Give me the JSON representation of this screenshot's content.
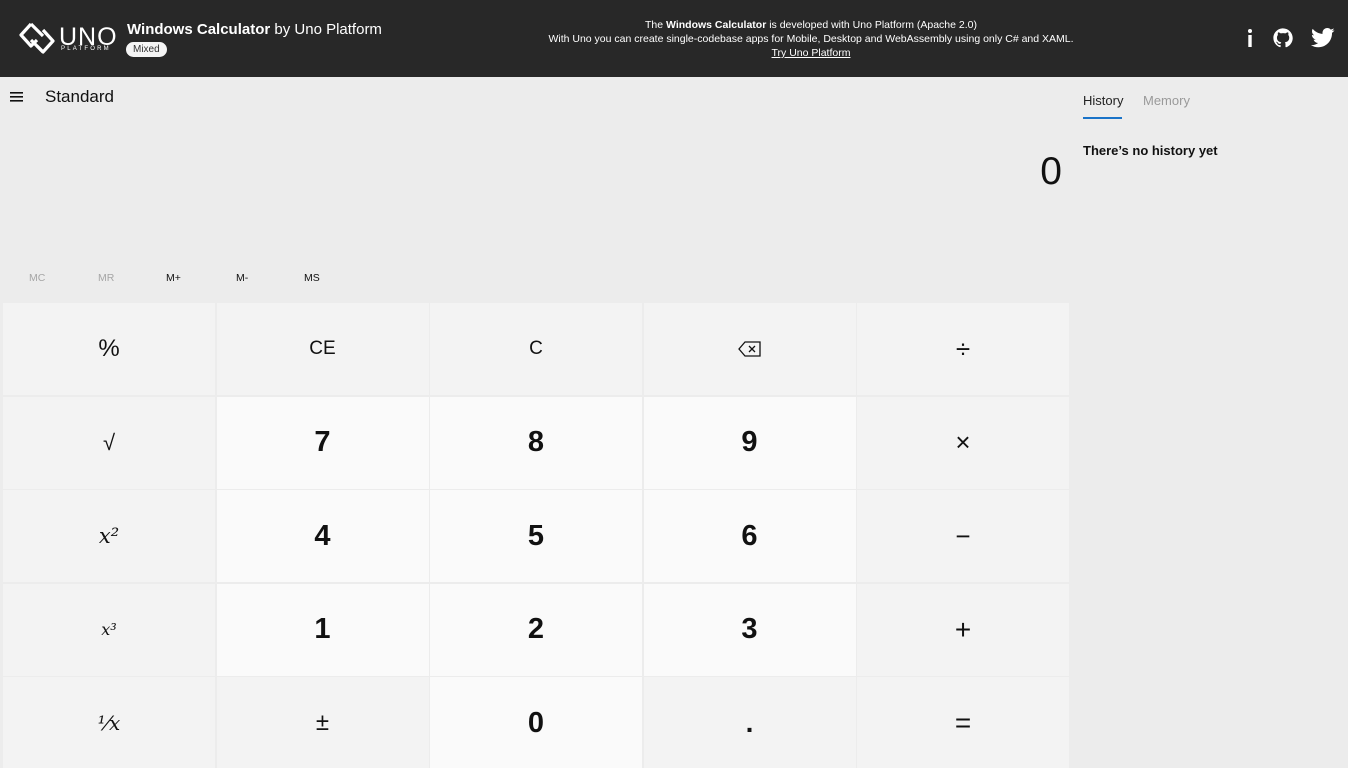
{
  "banner": {
    "logo_word": "UNO",
    "logo_sub": "PLATFORM",
    "brand_name": "Windows Calculator",
    "brand_suffix": " by Uno Platform",
    "badge": "Mixed",
    "notice_line1_pre": "The ",
    "notice_line1_bold": "Windows Calculator",
    "notice_line1_post": " is developed with Uno Platform (Apache 2.0)",
    "notice_line2": "With Uno you can create single-codebase apps for Mobile, Desktop and WebAssembly using only C# and XAML.",
    "notice_link": "Try Uno Platform",
    "icons": [
      "info-icon",
      "github-icon",
      "twitter-icon"
    ],
    "background": "#282828"
  },
  "header": {
    "menu_icon": "hamburger-menu-icon",
    "mode_title": "Standard"
  },
  "display": {
    "value": "0"
  },
  "memory": {
    "buttons": [
      {
        "label": "MC",
        "enabled": false
      },
      {
        "label": "MR",
        "enabled": false
      },
      {
        "label": "M+",
        "enabled": true
      },
      {
        "label": "M-",
        "enabled": true
      },
      {
        "label": "MS",
        "enabled": true
      }
    ]
  },
  "keypad": {
    "keys": [
      {
        "label": "%",
        "type": "fn"
      },
      {
        "label": "CE",
        "type": "fn"
      },
      {
        "label": "C",
        "type": "fn"
      },
      {
        "label": "⌫",
        "type": "fn",
        "icon": "backspace-icon"
      },
      {
        "label": "÷",
        "type": "fn"
      },
      {
        "label": "√",
        "type": "fn"
      },
      {
        "label": "7",
        "type": "num"
      },
      {
        "label": "8",
        "type": "num"
      },
      {
        "label": "9",
        "type": "num"
      },
      {
        "label": "×",
        "type": "fn"
      },
      {
        "label": "x²",
        "type": "fn"
      },
      {
        "label": "4",
        "type": "num"
      },
      {
        "label": "5",
        "type": "num"
      },
      {
        "label": "6",
        "type": "num"
      },
      {
        "label": "−",
        "type": "fn"
      },
      {
        "label": "x³",
        "type": "fn"
      },
      {
        "label": "1",
        "type": "num"
      },
      {
        "label": "2",
        "type": "num"
      },
      {
        "label": "3",
        "type": "num"
      },
      {
        "label": "+",
        "type": "fn"
      },
      {
        "label": "¹⁄x",
        "type": "fn"
      },
      {
        "label": "±",
        "type": "fn"
      },
      {
        "label": "0",
        "type": "num"
      },
      {
        "label": ".",
        "type": "fn"
      },
      {
        "label": "=",
        "type": "fn"
      }
    ]
  },
  "side_panel": {
    "tabs": [
      {
        "label": "History",
        "active": true
      },
      {
        "label": "Memory",
        "active": false
      }
    ],
    "empty_message": "There’s no history yet",
    "accent": "#1a73c8"
  }
}
